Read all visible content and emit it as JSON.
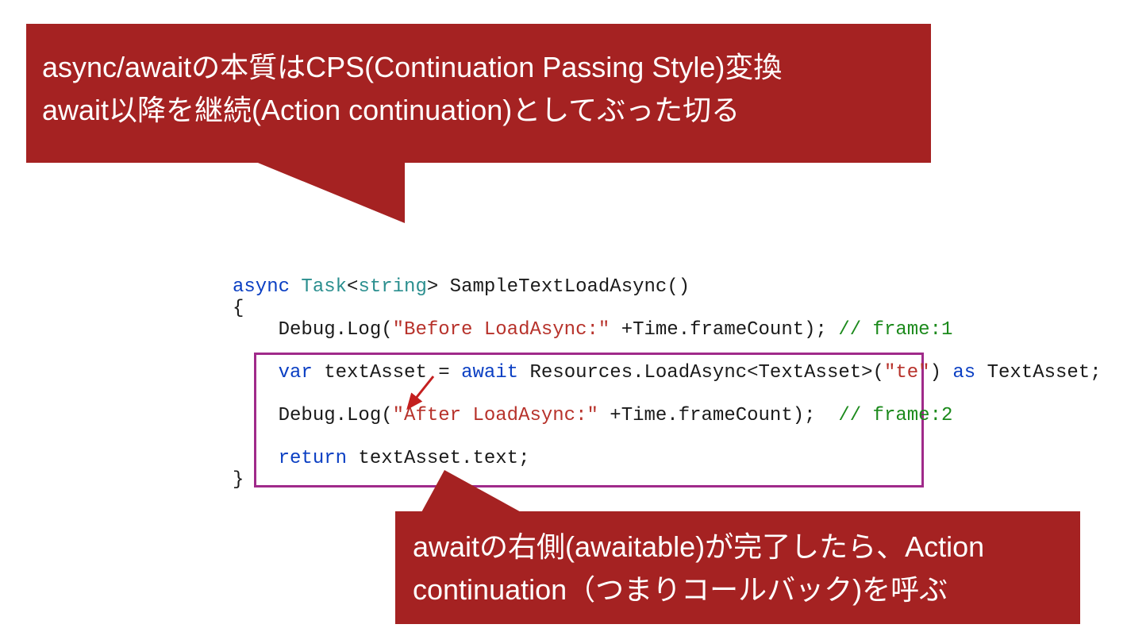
{
  "callout_top": {
    "line1": "async/awaitの本質はCPS(Continuation Passing Style)変換",
    "line2": "await以降を継続(Action continuation)としてぶった切る"
  },
  "callout_bot": {
    "line1": "awaitの右側(awaitable)が完了したら、Action",
    "line2": "continuation（つまりコールバック)を呼ぶ"
  },
  "code": {
    "kw_async": "async",
    "type_task": "Task",
    "lt": "<",
    "type_string": "string",
    "gt": ">",
    "sig_rest": " SampleTextLoadAsync()",
    "brace_open": "{",
    "indent": "    ",
    "indent2": "    ",
    "log_before_a": "Debug.Log(",
    "log_before_str": "\"Before LoadAsync:\"",
    "log_before_b": " +Time.frameCount); ",
    "log_before_cmt": "// frame:1",
    "kw_var": "var",
    "var_eq": " textAsset = ",
    "kw_await": "await",
    "load_call_a": " Resources.LoadAsync<TextAsset>(",
    "load_call_str": "\"te\"",
    "load_call_b": ") ",
    "kw_as": "as",
    "as_type": " TextAsset;",
    "log_after_a": "Debug.Log(",
    "log_after_str": "\"After LoadAsync:\"",
    "log_after_b": " +Time.frameCount);  ",
    "log_after_cmt": "// frame:2",
    "kw_return": "return",
    "return_expr": " textAsset.text;",
    "brace_close": "}"
  }
}
